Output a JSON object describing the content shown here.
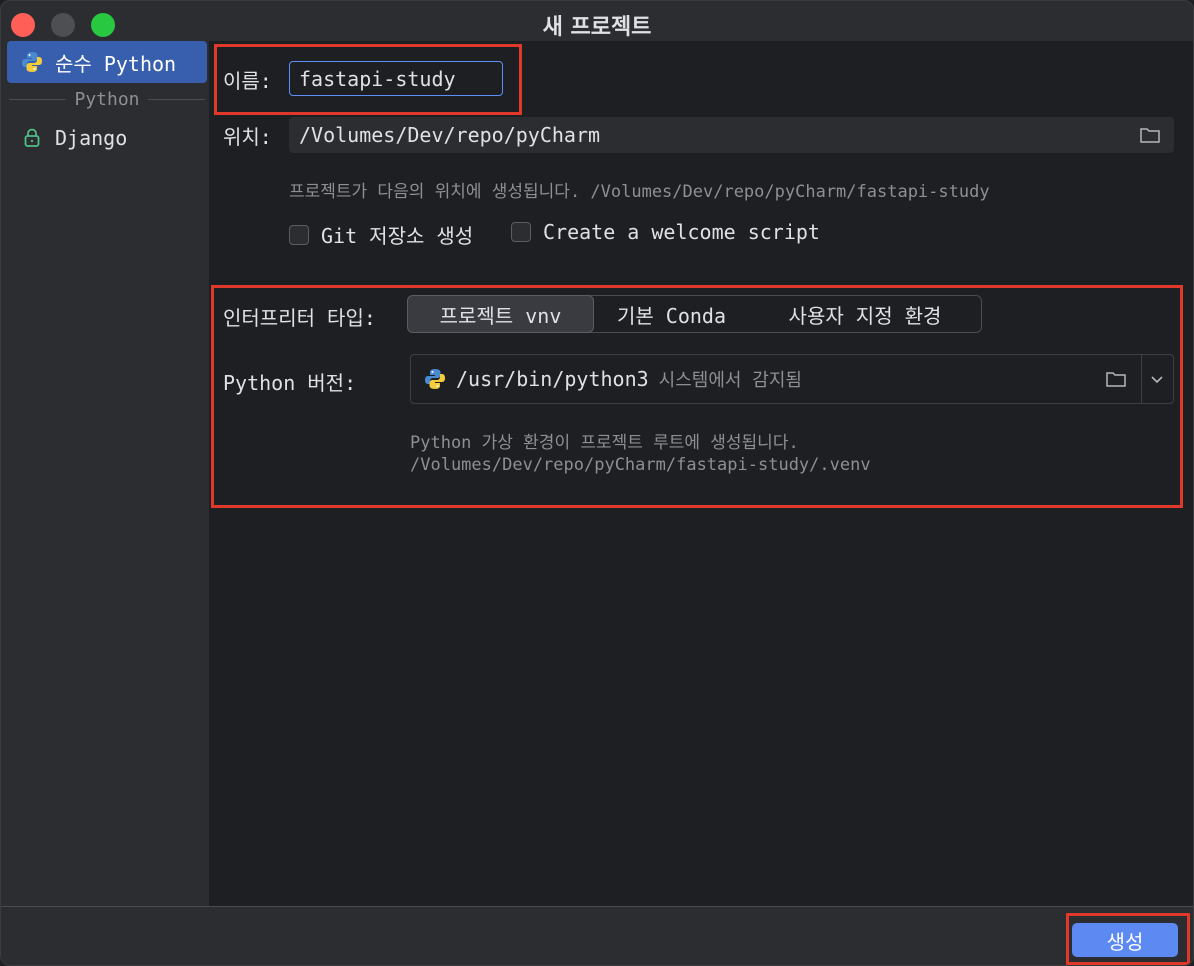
{
  "window": {
    "title": "새 프로젝트"
  },
  "sidebar": {
    "selected": "순수 Python",
    "separator": "Python",
    "items": [
      {
        "label": "순수 Python",
        "icon": "python-icon"
      },
      {
        "label": "Django",
        "icon": "lock-icon"
      }
    ]
  },
  "form": {
    "name_label": "이름:",
    "name_value": "fastapi-study",
    "location_label": "위치:",
    "location_value": "/Volumes/Dev/repo/pyCharm",
    "location_hint": "프로젝트가 다음의 위치에 생성됩니다. /Volumes/Dev/repo/pyCharm/fastapi-study",
    "git_checkbox": "Git 저장소 생성",
    "welcome_checkbox": "Create a welcome script"
  },
  "interpreter": {
    "type_label": "인터프리터 타입:",
    "options": [
      "프로젝트 vnv",
      "기본 Conda",
      "사용자 지정 환경"
    ],
    "selected": "프로젝트 vnv",
    "version_label": "Python 버전:",
    "version_value": "/usr/bin/python3",
    "version_detected": "시스템에서 감지됨",
    "hint_line1": "Python 가상 환경이 프로젝트 루트에 생성됩니다.",
    "hint_line2": "/Volumes/Dev/repo/pyCharm/fastapi-study/.venv"
  },
  "footer": {
    "create_label": "생성"
  },
  "colors": {
    "accent": "#5d89f3",
    "selection": "#375fad",
    "highlight_box": "#e0392b",
    "background": "#1e1f22"
  }
}
